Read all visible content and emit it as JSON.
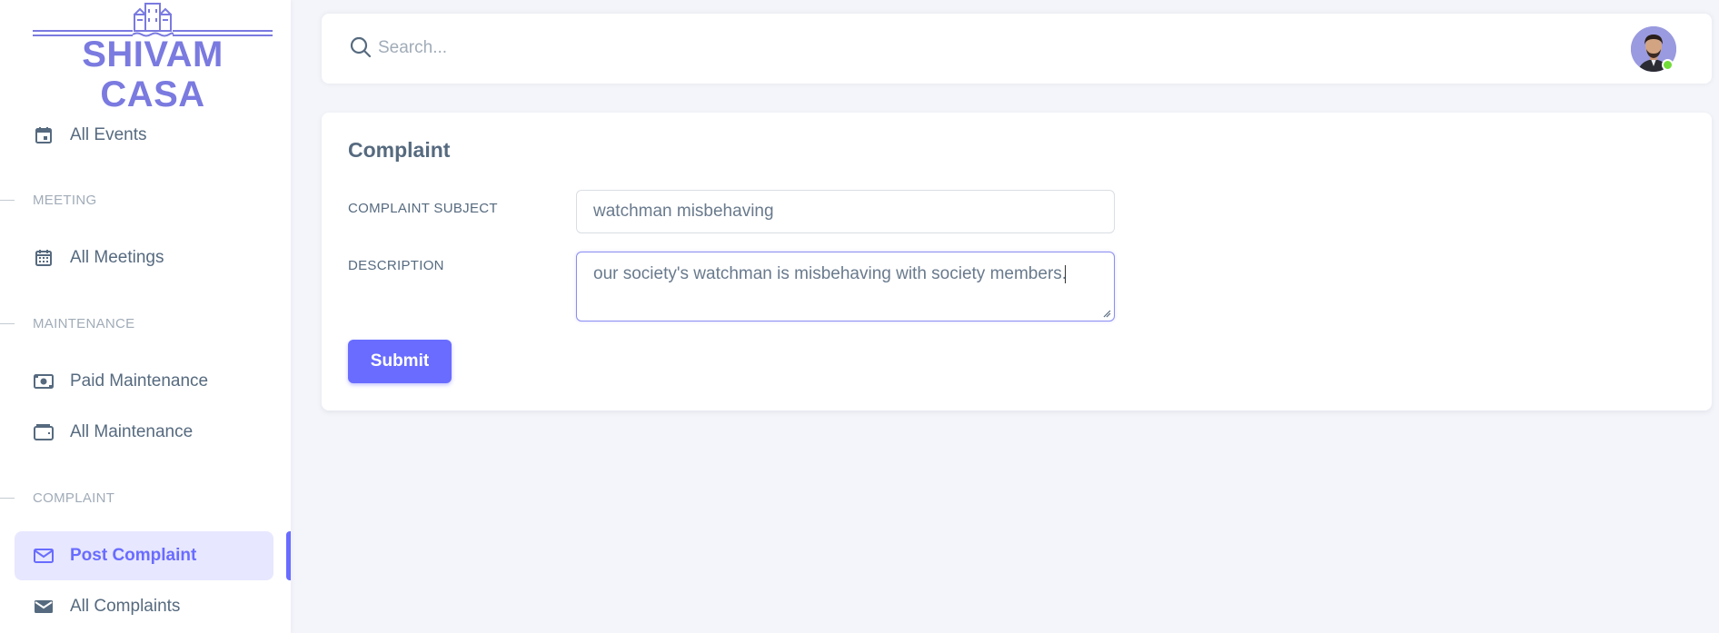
{
  "brand": {
    "name": "SHIVAM CASA",
    "color": "#7a7ae0",
    "icon": "building-icon"
  },
  "sidebar": {
    "sections": [
      {
        "header": "",
        "items": [
          {
            "label": "All Events",
            "icon": "calendar-event-icon"
          }
        ]
      },
      {
        "header": "MEETING",
        "items": [
          {
            "label": "All Meetings",
            "icon": "calendar-icon"
          }
        ]
      },
      {
        "header": "MAINTENANCE",
        "items": [
          {
            "label": "Paid Maintenance",
            "icon": "money-icon"
          },
          {
            "label": "All Maintenance",
            "icon": "wallet-icon"
          }
        ]
      },
      {
        "header": "COMPLAINT",
        "items": [
          {
            "label": "Post Complaint",
            "icon": "envelope-outline-icon",
            "active": true
          },
          {
            "label": "All Complaints",
            "icon": "envelope-filled-icon"
          }
        ]
      }
    ]
  },
  "navbar": {
    "search_placeholder": "Search...",
    "user_status": "online"
  },
  "form": {
    "title": "Complaint",
    "subject_label": "COMPLAINT SUBJECT",
    "subject_value": "watchman misbehaving",
    "description_label": "DESCRIPTION",
    "description_value": "our society's watchman is misbehaving with society members.",
    "submit_label": "Submit"
  },
  "colors": {
    "accent": "#696cff",
    "active_bg": "#e7e7ff",
    "status_online": "#71dd37"
  }
}
